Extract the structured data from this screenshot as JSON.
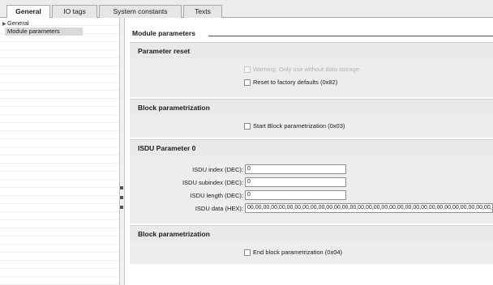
{
  "tabs": [
    {
      "label": "General",
      "active": true
    },
    {
      "label": "IO tags",
      "active": false
    },
    {
      "label": "System constants",
      "active": false
    },
    {
      "label": "Texts",
      "active": false
    }
  ],
  "navigation": {
    "items": [
      {
        "label": "General",
        "expandable": true,
        "selected": false
      },
      {
        "label": "Module parameters",
        "expandable": false,
        "selected": true
      }
    ]
  },
  "main": {
    "title": "Module parameters",
    "parameter_reset": {
      "heading": "Parameter reset",
      "warning_label": "Warning: Only use without data storage",
      "reset_label": "Reset to factory defaults (0x82)"
    },
    "block_start": {
      "heading": "Block parametrization",
      "start_label": "Start Block parametrization (0x03)"
    },
    "isdu": {
      "heading": "ISDU Parameter 0",
      "fields": [
        {
          "label": "ISDU index (DEC):",
          "value": "0"
        },
        {
          "label": "ISDU subindex (DEC):",
          "value": "0"
        },
        {
          "label": "ISDU length (DEC):",
          "value": "0"
        },
        {
          "label": "ISDU data (HEX):",
          "value": "00,00,00,00,00,00,00,00,00,00,00,00,00,00,00,00,00,00,00,00,00,00,00,00,00,00,00,00,00,00,00,00,00,00,00,00"
        }
      ]
    },
    "block_end": {
      "heading": "Block parametrization",
      "end_label": "End block parametrization (0x04)"
    }
  },
  "colors": {
    "section_header_bg": "#e9e9e9",
    "section_body_bg": "#ededed",
    "tab_strip_bg": "#ececec",
    "selected_nav_bg": "#d9d9d9"
  }
}
